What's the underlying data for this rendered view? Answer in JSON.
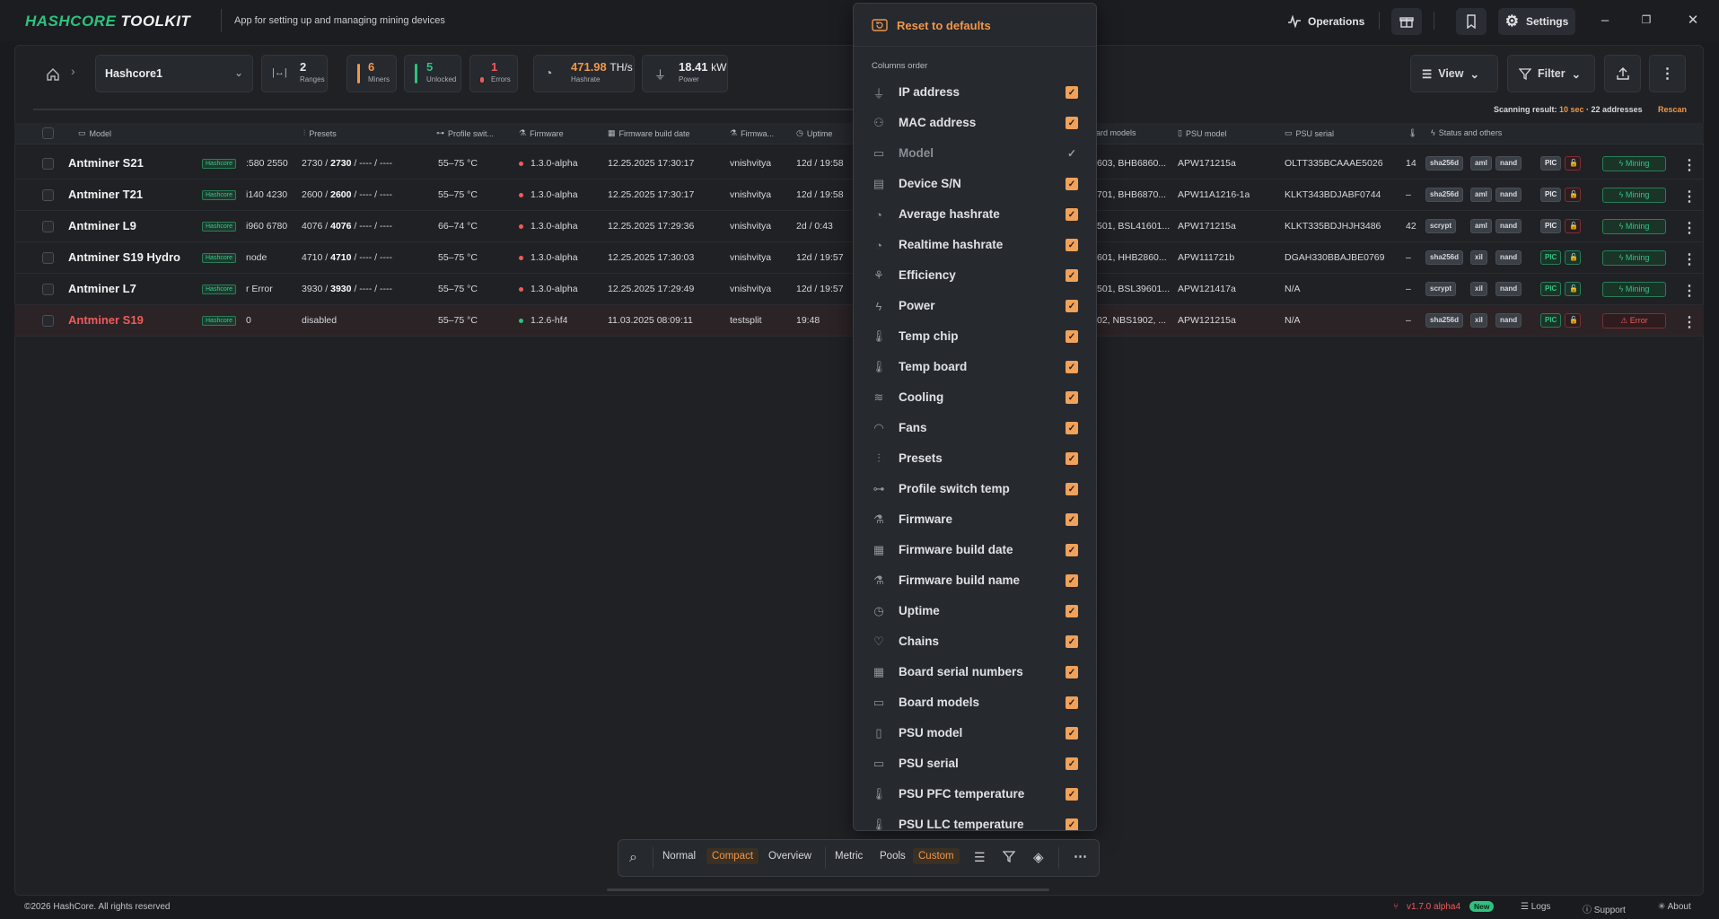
{
  "app": {
    "title_a": "HASHCORE",
    "title_b": " TOOLKIT",
    "tagline": "App for setting up and managing mining devices"
  },
  "titlebar": {
    "operations": "Operations",
    "settings": "Settings"
  },
  "toolbar": {
    "site": "Hashcore1",
    "ranges_num": "2",
    "ranges_lbl": "Ranges",
    "miners_num": "6",
    "miners_lbl": "Miners",
    "unlocked_num": "5",
    "unlocked_lbl": "Unlocked",
    "errors_num": "1",
    "errors_lbl": "Errors",
    "hashrate_val": "471.98",
    "hashrate_unit": "TH/s",
    "hashrate_lbl": "Hashrate",
    "power_val": "18.41",
    "power_unit": "kW",
    "power_lbl": "Power",
    "view": "View",
    "filter": "Filter"
  },
  "scan": {
    "prefix": "Scanning result: ",
    "time": "10 sec",
    "suffix": " · 22 addresses",
    "rescan": "Rescan"
  },
  "columns": {
    "model": "Model",
    "presets": "Presets",
    "profile": "Profile swit...",
    "firmware": "Firmware",
    "fw_date": "Firmware build date",
    "fw_name": "Firmwa...",
    "uptime": "Uptime",
    "board_models": "ard models",
    "psu_model": "PSU model",
    "psu_serial": "PSU serial",
    "status": "Status and others"
  },
  "rows": [
    {
      "model": "Antminer S21",
      "tag": "Hashcore",
      "col2": ":580 2550",
      "presets_a": "2730 / ",
      "presets_b": "2730",
      "presets_c": " / ---- / ----",
      "temp": "55–75 °C",
      "fw": "1.3.0-alpha",
      "fw_date": "12.25.2025 17:30:17",
      "fw_name": "vnishvitya",
      "uptime": "12d / 19:58",
      "boards": "603, BHB6860...",
      "psu": "APW171215a",
      "serial": "OLTT335BCAAAE5026",
      "ll": "14",
      "algo": "sha256d",
      "p2": "aml",
      "p3": "nand",
      "pic": "PIC",
      "status": "Mining"
    },
    {
      "model": "Antminer T21",
      "tag": "Hashcore",
      "col2": "i140 4230",
      "presets_a": "2600 / ",
      "presets_b": "2600",
      "presets_c": " / ---- / ----",
      "temp": "55–75 °C",
      "fw": "1.3.0-alpha",
      "fw_date": "12.25.2025 17:30:17",
      "fw_name": "vnishvitya",
      "uptime": "12d / 19:58",
      "boards": "701, BHB6870...",
      "psu": "APW11A1216-1a",
      "serial": "KLKT343BDJABF0744",
      "ll": "–",
      "algo": "sha256d",
      "p2": "aml",
      "p3": "nand",
      "pic": "PIC",
      "status": "Mining"
    },
    {
      "model": "Antminer L9",
      "tag": "Hashcore",
      "col2": "i960 6780",
      "presets_a": "4076 / ",
      "presets_b": "4076",
      "presets_c": " / ---- / ----",
      "temp": "66–74 °C",
      "fw": "1.3.0-alpha",
      "fw_date": "12.25.2025 17:29:36",
      "fw_name": "vnishvitya",
      "uptime": "2d / 0:43",
      "boards": "501, BSL41601...",
      "psu": "APW171215a",
      "serial": "KLKT335BDJHJH3486",
      "ll": "42",
      "algo": "scrypt",
      "p2": "aml",
      "p3": "nand",
      "pic": "PIC",
      "status": "Mining"
    },
    {
      "model": "Antminer S19 Hydro",
      "tag": "Hashcore",
      "col2": "node",
      "presets_a": "4710 / ",
      "presets_b": "4710",
      "presets_c": " / ---- / ----",
      "temp": "55–75 °C",
      "fw": "1.3.0-alpha",
      "fw_date": "12.25.2025 17:30:03",
      "fw_name": "vnishvitya",
      "uptime": "12d / 19:57",
      "boards": "601, HHB2860...",
      "psu": "APW111721b",
      "serial": "DGAH330BBAJBE0769",
      "ll": "–",
      "algo": "sha256d",
      "p2": "xil",
      "p3": "nand",
      "pic": "PIC",
      "status": "Mining"
    },
    {
      "model": "Antminer L7",
      "tag": "Hashcore",
      "col2": "r Error",
      "presets_a": "3930 / ",
      "presets_b": "3930",
      "presets_c": " / ---- / ----",
      "temp": "55–75 °C",
      "fw": "1.3.0-alpha",
      "fw_date": "12.25.2025 17:29:49",
      "fw_name": "vnishvitya",
      "uptime": "12d / 19:57",
      "boards": "501, BSL39601...",
      "psu": "APW121417a",
      "serial": "N/A",
      "ll": "–",
      "algo": "scrypt",
      "p2": "xil",
      "p3": "nand",
      "pic": "PIC",
      "status": "Mining"
    },
    {
      "model": "Antminer S19",
      "tag": "Hashcore",
      "col2": "0",
      "presets_a": "disabled",
      "presets_b": "",
      "presets_c": "",
      "temp": "55–75 °C",
      "fw": "1.2.6-hf4",
      "fw_date": "11.03.2025 08:09:11",
      "fw_name": "testsplit",
      "uptime": "19:48",
      "boards": "02, NBS1902, ...",
      "psu": "APW121215a",
      "serial": "N/A",
      "ll": "–",
      "algo": "sha256d",
      "p2": "xil",
      "p3": "nand",
      "pic": "PIC",
      "status": "Error"
    }
  ],
  "menu": {
    "reset": "Reset to defaults",
    "section": "Columns order",
    "items": [
      "IP address",
      "MAC address",
      "Model",
      "Device S/N",
      "Average hashrate",
      "Realtime hashrate",
      "Efficiency",
      "Power",
      "Temp chip",
      "Temp board",
      "Cooling",
      "Fans",
      "Presets",
      "Profile switch temp",
      "Firmware",
      "Firmware build date",
      "Firmware build name",
      "Uptime",
      "Chains",
      "Board serial numbers",
      "Board models",
      "PSU model",
      "PSU serial",
      "PSU PFC temperature",
      "PSU LLC temperature"
    ]
  },
  "bottom": {
    "normal": "Normal",
    "compact": "Compact",
    "overview": "Overview",
    "metric": "Metric",
    "pools": "Pools",
    "custom": "Custom"
  },
  "footer": {
    "copyright": "©2026 HashCore. All rights reserved",
    "version": "v1.7.0 alpha4",
    "new": "New",
    "logs": "Logs",
    "support": "Support",
    "about": "About"
  },
  "colors": {
    "accent": "#f0974a",
    "green": "#2ec27e",
    "red": "#ef5b5b"
  }
}
